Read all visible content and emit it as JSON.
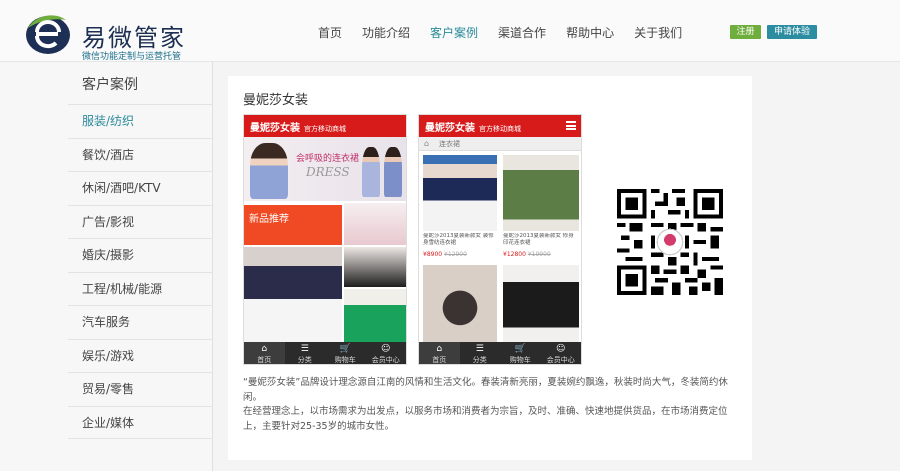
{
  "brand": {
    "title": "易微管家",
    "subtitle": "微信功能定制与运营托管"
  },
  "nav": [
    {
      "label": "首页",
      "active": false
    },
    {
      "label": "功能介绍",
      "active": false
    },
    {
      "label": "客户案例",
      "active": true
    },
    {
      "label": "渠道合作",
      "active": false
    },
    {
      "label": "帮助中心",
      "active": false
    },
    {
      "label": "关于我们",
      "active": false
    }
  ],
  "buttons": {
    "register": "注册",
    "trial": "申请体验"
  },
  "sidebar": {
    "title": "客户案例",
    "items": [
      {
        "label": "服装/纺织",
        "active": true
      },
      {
        "label": "餐饮/酒店",
        "active": false
      },
      {
        "label": "休闲/酒吧/KTV",
        "active": false
      },
      {
        "label": "广告/影视",
        "active": false
      },
      {
        "label": "婚庆/摄影",
        "active": false
      },
      {
        "label": "工程/机械/能源",
        "active": false
      },
      {
        "label": "汽车服务",
        "active": false
      },
      {
        "label": "娱乐/游戏",
        "active": false
      },
      {
        "label": "贸易/零售",
        "active": false
      },
      {
        "label": "企业/媒体",
        "active": false
      }
    ]
  },
  "case": {
    "title": "曼妮莎女装",
    "phone_brand": "曼妮莎女装",
    "phone_brand_sub": "官方移动商城",
    "banner_text": "会呼吸的连衣裙",
    "banner_dress": "DRESS",
    "new_label": "新品推荐",
    "sub_bar": "连衣裙",
    "products": [
      {
        "desc": "曼妮莎2013夏装新款女 装修身雪纺连衣裙",
        "price": "¥8900",
        "old": "¥12900"
      },
      {
        "desc": "曼妮莎2013夏装新款女 修身印花连衣裙",
        "price": "¥12800",
        "old": "¥19900"
      }
    ],
    "tabs": [
      {
        "icon": "⌂",
        "label": "首页"
      },
      {
        "icon": "☰",
        "label": "分类"
      },
      {
        "icon": "🛒",
        "label": "购物车"
      },
      {
        "icon": "☺",
        "label": "会员中心"
      }
    ],
    "description_1": "“曼妮莎女装”品牌设计理念源自江南的风情和生活文化。春装清新亮丽，夏装婉约飘逸，秋装时尚大气，冬装简约休闲。",
    "description_2": "在经营理念上，以市场需求为出发点，以服务市场和消费者为宗旨，及时、准确、快速地提供货品，在市场消费定位上，主要针对25-35岁的城市女性。"
  },
  "colors": {
    "accent": "#2a8a9a",
    "phone_red": "#d71b1b",
    "register_green": "#6fae3c",
    "trial_teal": "#2c8da1"
  }
}
